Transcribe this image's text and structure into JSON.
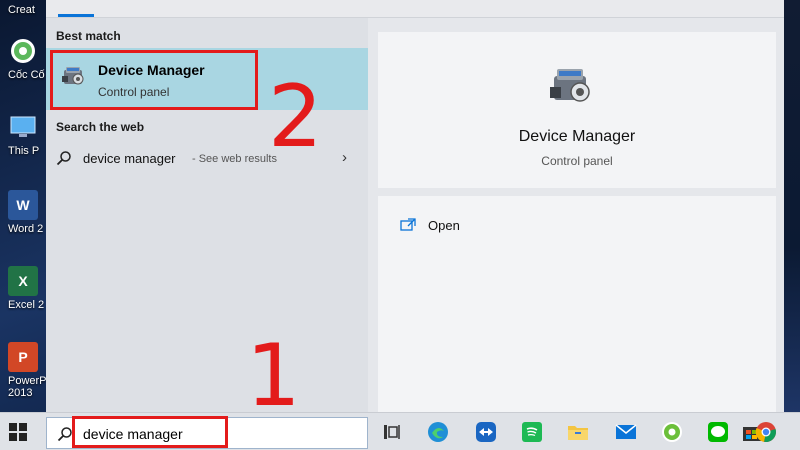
{
  "desktop": {
    "icons": [
      {
        "name": "desktop-icon-creative",
        "label": "Creat",
        "color": "#cccccc"
      },
      {
        "name": "desktop-icon-coc-coc",
        "label": "Cốc Cố",
        "color": "#46a546"
      },
      {
        "name": "desktop-icon-this-pc",
        "label": "This P",
        "color": "#3a8fd6"
      },
      {
        "name": "desktop-icon-word",
        "label": "Word 2",
        "color": "#2b579a"
      },
      {
        "name": "desktop-icon-excel",
        "label": "Excel 2",
        "color": "#217346"
      },
      {
        "name": "desktop-icon-powerpoint",
        "label": "PowerP",
        "label2": "2013",
        "color": "#d24726"
      }
    ]
  },
  "search_panel": {
    "best_match_title": "Best match",
    "best_match": {
      "title": "Device Manager",
      "subtitle": "Control panel",
      "icon": "device-manager-icon"
    },
    "search_web_title": "Search the web",
    "web_result": {
      "query": "device manager",
      "note": "- See web results"
    },
    "detail": {
      "title": "Device Manager",
      "subtitle": "Control panel",
      "open_label": "Open"
    }
  },
  "taskbar": {
    "search_text": "device manager",
    "icons": [
      "task-view-icon",
      "edge-icon",
      "teamviewer-icon",
      "spotify-icon",
      "file-explorer-icon",
      "mail-icon",
      "coc-coc-icon",
      "line-icon",
      "store-icon",
      "chrome-icon"
    ]
  },
  "annotations": {
    "step1": "1",
    "step2": "2",
    "color": "#e31b1b"
  },
  "colors": {
    "selected_bg": "#a9d6e2",
    "accent": "#0a74d8"
  }
}
